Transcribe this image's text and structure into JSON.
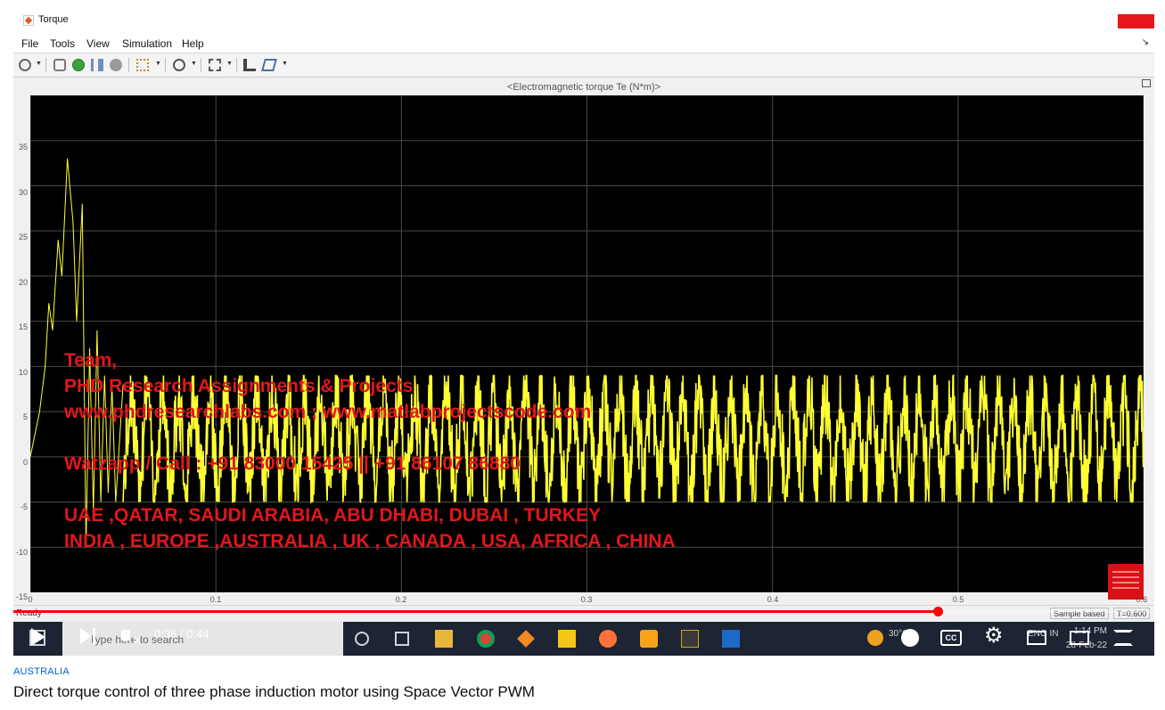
{
  "window": {
    "title": "Torque"
  },
  "menu": {
    "items": [
      "File",
      "Tools",
      "View",
      "Simulation",
      "Help"
    ],
    "collapse": "↘"
  },
  "scope": {
    "plot_title": "<Electromagnetic torque Te (N*m)>"
  },
  "chart_data": {
    "type": "line",
    "title": "<Electromagnetic torque Te (N*m)>",
    "xlim": [
      0,
      0.6
    ],
    "ylim": [
      -15,
      40
    ],
    "x_ticks": [
      "0",
      "0.1",
      "0.2",
      "0.3",
      "0.4",
      "0.5",
      "0.6"
    ],
    "y_ticks": [
      "35",
      "30",
      "25",
      "20",
      "15",
      "10",
      "5",
      "0",
      "-5",
      "-10",
      "-15"
    ],
    "grid": true,
    "series": [
      {
        "color": "#ffff33",
        "x": [
          0,
          0.002,
          0.005,
          0.008,
          0.01,
          0.012,
          0.015,
          0.017,
          0.02,
          0.023,
          0.025,
          0.028,
          0.03,
          0.032,
          0.034,
          0.036,
          0.038,
          0.04,
          0.042,
          0.044,
          0.046,
          0.05,
          0.06,
          0.1,
          0.2,
          0.3,
          0.4,
          0.5,
          0.6
        ],
        "y": [
          0,
          2,
          5,
          10,
          17,
          14,
          24,
          20,
          33,
          26,
          15,
          28,
          -10,
          12,
          -6,
          14,
          -5,
          9,
          -4,
          8,
          -5,
          8,
          -5,
          8,
          -5,
          8,
          -5,
          9,
          -3
        ],
        "envelope_after_0_05": {
          "min": -5,
          "max": 9
        }
      }
    ]
  },
  "watermark": {
    "lines": [
      "Team,",
      "PHD Research Assignments & Projects",
      "www.phdresearchlabs.com ; www.matlabprojectscode.com",
      "",
      "Watzapp / Call : +91 83000 15425 || +91 86107 86880",
      "",
      "UAE ,QATAR, SAUDI ARABIA, ABU DHABI, DUBAI , TURKEY",
      "INDIA , EUROPE ,AUSTRALIA , UK , CANADA , USA, AFRICA , CHINA"
    ]
  },
  "status": {
    "ready": "Ready",
    "sample_based": "Sample based",
    "time": "T=0.600"
  },
  "player": {
    "time": "0:36 / 0:44",
    "progress_fraction": 0.81
  },
  "taskbar": {
    "search_placeholder": "Type here to search",
    "clock_time": "1:14 PM",
    "clock_date": "28-Feb-22",
    "lang": "ENG IN",
    "weather": "30°C"
  },
  "video": {
    "channel": "AUSTRALIA",
    "title": "Direct torque control of three phase induction motor using Space Vector PWM"
  },
  "colors": {
    "trace": "#ffff33",
    "watermark": "#e3161c",
    "progress": "#ff0000",
    "channel": "#065fd4"
  }
}
